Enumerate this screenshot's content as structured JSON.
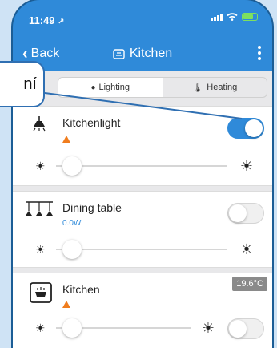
{
  "statusbar": {
    "time": "11:49",
    "location_glyph": "↗"
  },
  "navbar": {
    "back_label": "Back",
    "title": "Kitchen"
  },
  "segments": [
    {
      "label": "Lighting",
      "active": true,
      "icon": "bulb-icon"
    },
    {
      "label": "Heating",
      "active": false,
      "icon": "thermometer-icon"
    }
  ],
  "devices": [
    {
      "name": "Kitchenlight",
      "sub": "",
      "toggle_on": true,
      "icon": "ceiling-lamp-icon",
      "warning": true,
      "brightness_fraction": 0.0
    },
    {
      "name": "Dining table",
      "sub": "0.0W",
      "toggle_on": false,
      "icon": "pendant-lamps-icon",
      "warning": false,
      "brightness_fraction": 0.0
    },
    {
      "name": "Kitchen",
      "sub": "",
      "toggle_on": false,
      "icon": "stove-icon",
      "warning": true,
      "temperature": "19.6°C",
      "brightness_fraction": 0.0
    }
  ],
  "callout": {
    "text": "ní"
  },
  "colors": {
    "accent": "#2f8ad9",
    "warning": "#f07d1e",
    "badge": "#8a8a8a"
  }
}
